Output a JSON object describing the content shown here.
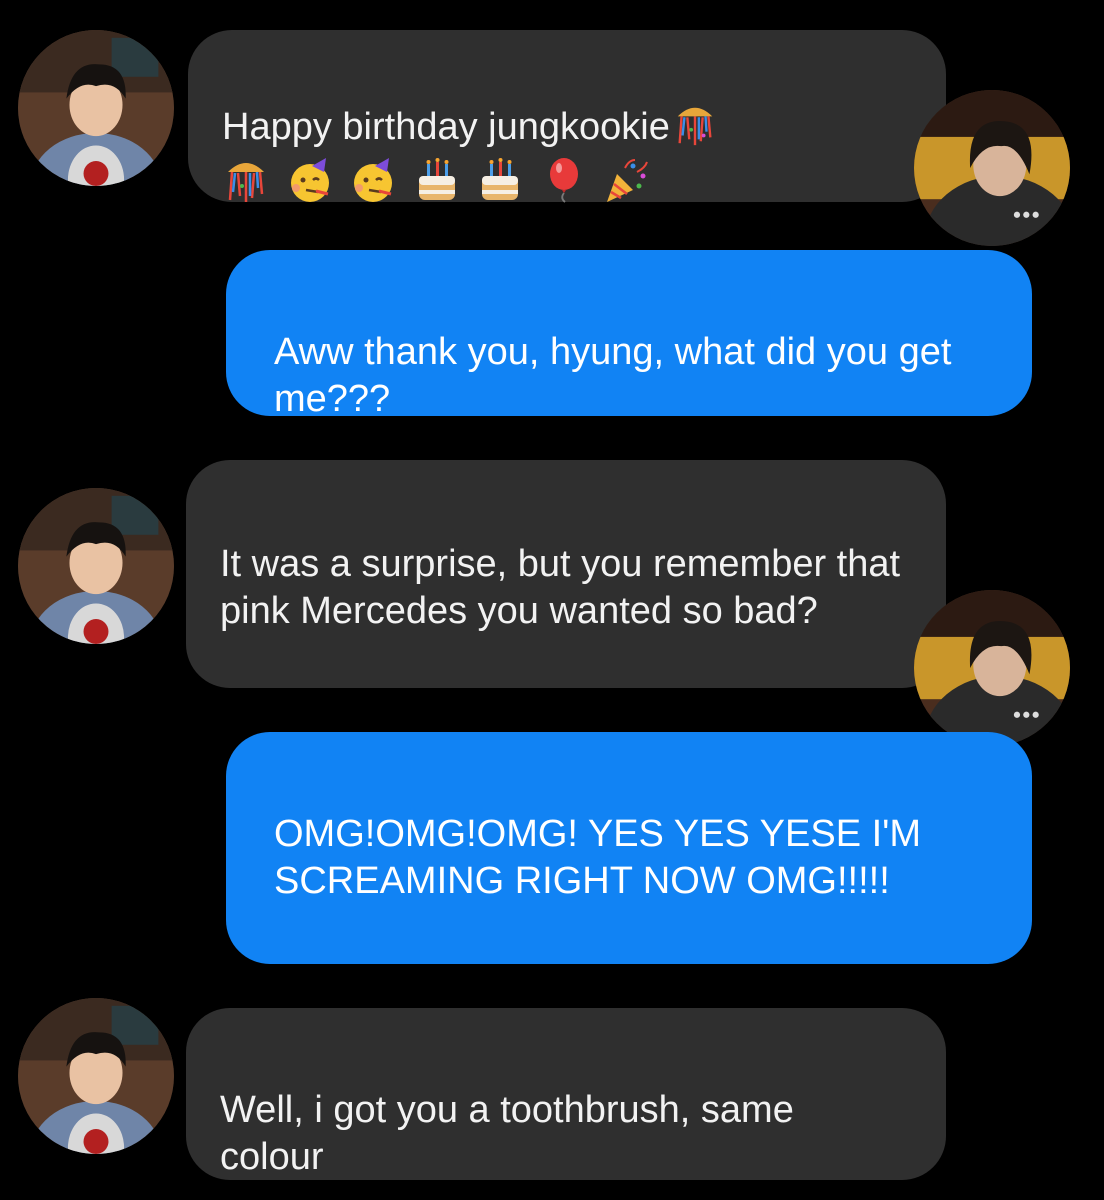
{
  "conversation": {
    "messages": [
      {
        "sender": "them",
        "text": "Happy birthday jungkookie",
        "emojis": [
          "confetti-ball",
          "confetti-ball",
          "partying-face",
          "partying-face",
          "birthday-cake",
          "birthday-cake",
          "balloon",
          "party-popper"
        ]
      },
      {
        "sender": "me",
        "text": "Aww thank you, hyung, what did you get me???"
      },
      {
        "sender": "them",
        "text": "It was a surprise, but you remember that pink Mercedes you wanted so bad?"
      },
      {
        "sender": "me",
        "text": "OMG!OMG!OMG! YES YES YESE I'M SCREAMING RIGHT NOW OMG!!!!!"
      },
      {
        "sender": "them",
        "text": "Well, i got you a toothbrush, same colour"
      }
    ]
  },
  "colors": {
    "background": "#000000",
    "received_bubble": "#2f2f2f",
    "sent_bubble": "#1183f4",
    "text": "#f2f2f2"
  }
}
